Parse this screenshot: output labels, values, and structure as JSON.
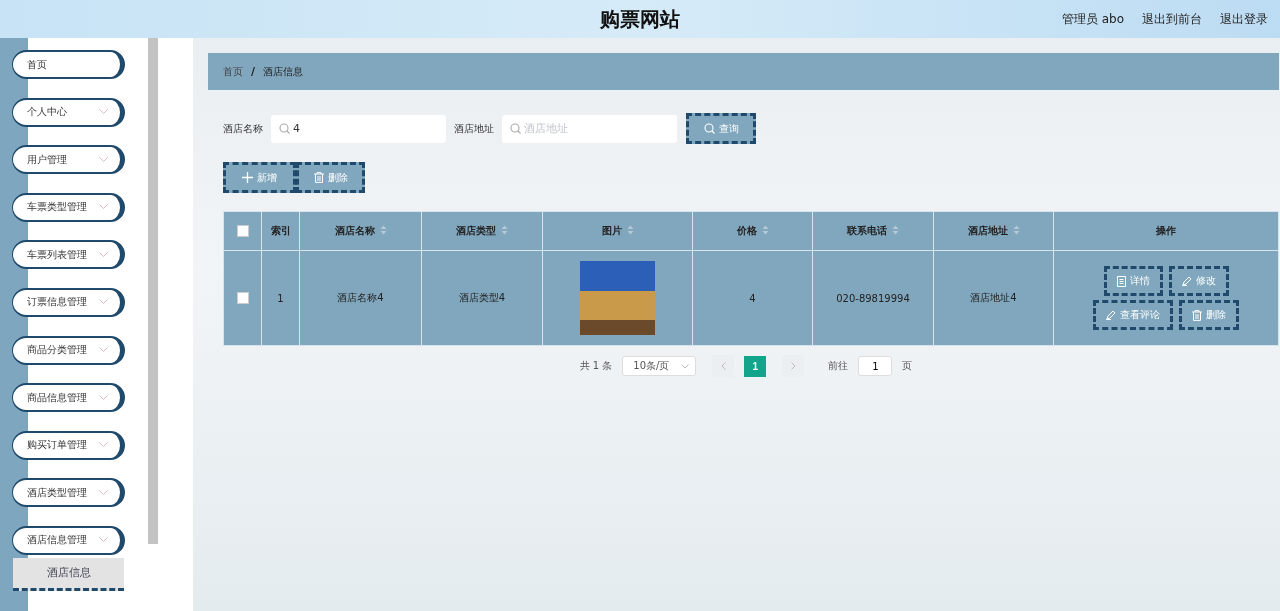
{
  "header": {
    "title": "购票网站",
    "links": [
      "管理员 abo",
      "退出到前台",
      "退出登录"
    ]
  },
  "sidebar": {
    "items": [
      {
        "label": "首页",
        "expandable": false,
        "selected": false
      },
      {
        "label": "个人中心",
        "expandable": true,
        "selected": false
      },
      {
        "label": "用户管理",
        "expandable": true,
        "selected": false
      },
      {
        "label": "车票类型管理",
        "expandable": true,
        "selected": false
      },
      {
        "label": "车票列表管理",
        "expandable": true,
        "selected": false
      },
      {
        "label": "订票信息管理",
        "expandable": true,
        "selected": false
      },
      {
        "label": "商品分类管理",
        "expandable": true,
        "selected": false
      },
      {
        "label": "商品信息管理",
        "expandable": true,
        "selected": false
      },
      {
        "label": "购买订单管理",
        "expandable": true,
        "selected": false
      },
      {
        "label": "酒店类型管理",
        "expandable": true,
        "selected": false
      },
      {
        "label": "酒店信息管理",
        "expandable": true,
        "selected": false,
        "children": [
          {
            "label": "酒店信息",
            "selected": true
          }
        ]
      }
    ]
  },
  "breadcrumb": {
    "items": [
      "首页",
      "酒店信息"
    ],
    "separator": "/"
  },
  "search": {
    "fields": [
      {
        "label": "酒店名称",
        "value": "4"
      },
      {
        "label": "酒店地址",
        "placeholder": "酒店地址"
      }
    ],
    "button": "查询"
  },
  "actions": [
    {
      "label": "新增",
      "kind": "add"
    },
    {
      "label": "删除",
      "kind": "delete"
    }
  ],
  "table": {
    "columns": [
      {
        "label": "索引",
        "sortable": false
      },
      {
        "label": "酒店名称",
        "sortable": true
      },
      {
        "label": "酒店类型",
        "sortable": true
      },
      {
        "label": "图片",
        "sortable": true
      },
      {
        "label": "价格",
        "sortable": true
      },
      {
        "label": "联系电话",
        "sortable": true
      },
      {
        "label": "酒店地址",
        "sortable": true
      },
      {
        "label": "操作",
        "sortable": false
      }
    ],
    "header_checked": false,
    "rows": [
      {
        "checked": false,
        "index": "1",
        "name": "酒店名称4",
        "type": "酒店类型4",
        "price": "4",
        "phone": "020-89819994",
        "address": "酒店地址4",
        "buttons": [
          {
            "label": "详情",
            "kind": "detail"
          },
          {
            "label": "修改",
            "kind": "edit"
          },
          {
            "label": "查看评论",
            "kind": "edit"
          },
          {
            "label": "删除",
            "kind": "delete"
          }
        ]
      }
    ]
  },
  "pagination": {
    "total": "共 1 条",
    "page_size": "10条/页",
    "pages": [
      {
        "label": "1",
        "selected": true
      }
    ],
    "goto_label": "前往",
    "goto_value": "1",
    "goto_suffix": "页"
  }
}
